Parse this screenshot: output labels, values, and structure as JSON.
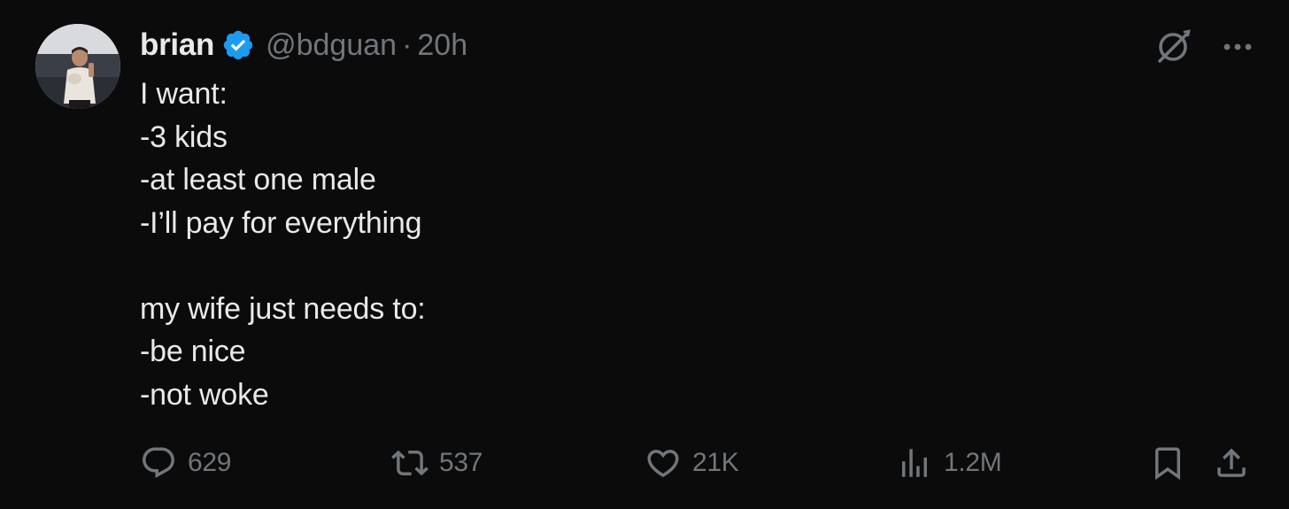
{
  "user": {
    "display_name": "brian",
    "handle": "@bdguan",
    "separator": "·",
    "time": "20h",
    "verified": true,
    "verified_color": "#1d9bf0"
  },
  "tweet": {
    "lines": [
      "I want:",
      "-3 kids",
      "-at least one male",
      "-I’ll pay for everything",
      "",
      "my wife just needs to:",
      "-be nice",
      "-not woke"
    ]
  },
  "actions": {
    "reply": {
      "icon": "reply-icon",
      "count": "629"
    },
    "retweet": {
      "icon": "retweet-icon",
      "count": "537"
    },
    "like": {
      "icon": "heart-icon",
      "count": "21K"
    },
    "views": {
      "icon": "views-icon",
      "count": "1.2M"
    },
    "bookmark": {
      "icon": "bookmark-icon"
    },
    "share": {
      "icon": "share-icon"
    }
  },
  "top_actions": {
    "grok": {
      "icon": "grok-icon"
    },
    "more": {
      "icon": "more-icon"
    }
  },
  "colors": {
    "background": "#0b0b0c",
    "text": "#e7e9ea",
    "muted": "#71767b"
  }
}
